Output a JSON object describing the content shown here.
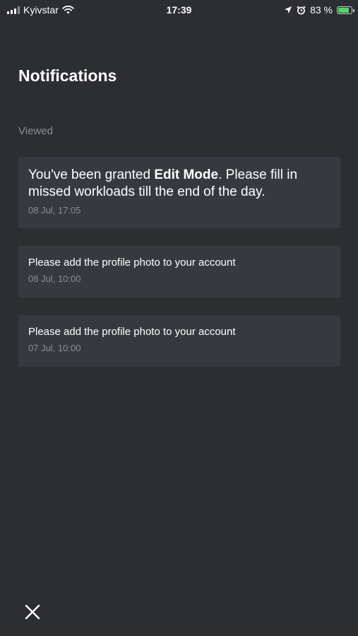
{
  "status_bar": {
    "carrier": "Kyivstar",
    "time": "17:39",
    "battery_percent": "83 %",
    "battery_level": 0.83
  },
  "header": {
    "title": "Notifications"
  },
  "section": {
    "label": "Viewed"
  },
  "notifications": [
    {
      "text_before": "You've been granted ",
      "text_bold": "Edit Mode",
      "text_after": ". Please fill in missed workloads till the end of the day.",
      "time": "08 Jul, 17:05"
    },
    {
      "text": "Please add the profile photo to your account",
      "time": "08 Jul, 10:00"
    },
    {
      "text": "Please add the profile photo to your account",
      "time": "07 Jul, 10:00"
    }
  ],
  "icons": {
    "close": "close-icon",
    "wifi": "wifi-icon",
    "location": "location-arrow-icon",
    "alarm": "alarm-clock-icon",
    "battery": "battery-charging-icon",
    "signal": "cellular-signal-icon"
  },
  "colors": {
    "background": "#2c2e32",
    "card": "#363a40",
    "muted_text": "#8d9095",
    "battery_fill": "#4cd964"
  }
}
